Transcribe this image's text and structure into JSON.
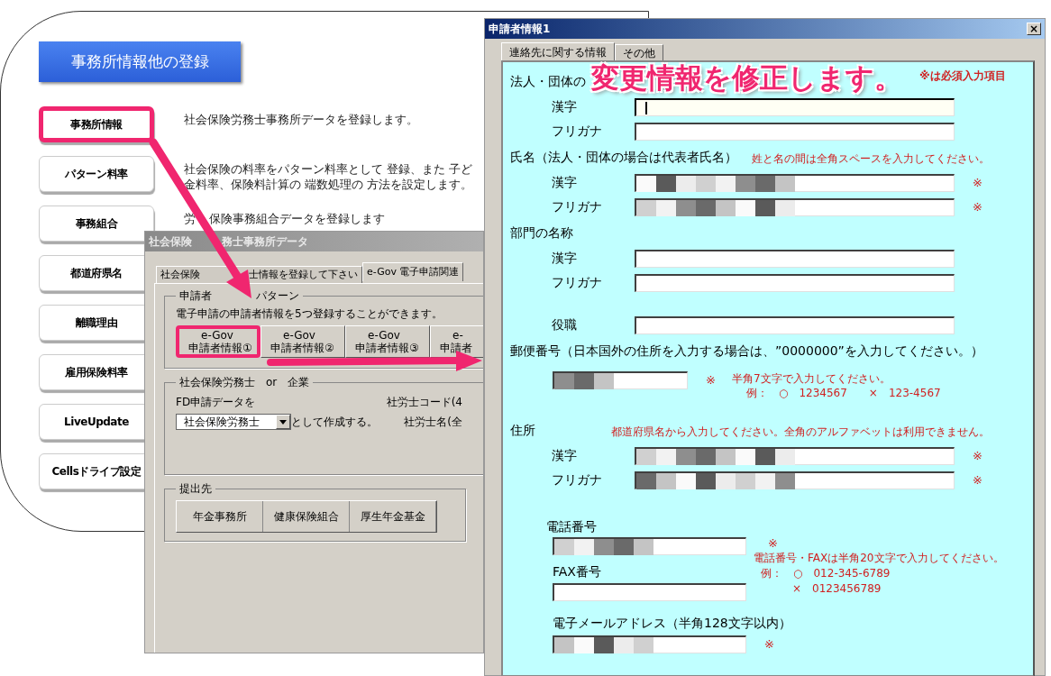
{
  "left_panel": {
    "header": "事務所情報他の登録",
    "items": [
      {
        "label": "事務所情報",
        "highlighted": true,
        "description": [
          [
            "社会保険労務士事務所データを登録します。"
          ]
        ]
      },
      {
        "label": "パターン料率",
        "highlighted": false,
        "description": [
          [
            "社会保険の料率をパターン料率として 登録、また 子ど"
          ],
          [
            "金料率、保険料計算の 端数処理の 方法を設定します。"
          ]
        ]
      },
      {
        "label": "事務組合",
        "highlighted": false,
        "description": [
          [
            "労",
            "保険事務組合データを登録します"
          ]
        ]
      },
      {
        "label": "都道府県名",
        "highlighted": false
      },
      {
        "label": "離職理由",
        "highlighted": false
      },
      {
        "label": "雇用保険料率",
        "highlighted": false
      },
      {
        "label": "LiveUpdate",
        "highlighted": false
      },
      {
        "label": "Cellsドライブ設定",
        "highlighted": false
      }
    ]
  },
  "office_dialog": {
    "title": [
      "社会保険",
      "務士事務所データ"
    ],
    "tabs": [
      {
        "label": [
          "社会保険",
          "士情報を登録して下さい"
        ],
        "selected": false
      },
      {
        "label": [
          "e-Gov 電子申請関連"
        ],
        "selected": true
      }
    ],
    "pattern_group": {
      "legend": [
        "申請者",
        "パターン"
      ],
      "text": "電子申請の申請者情報を5つ登録することができます。",
      "buttons": [
        {
          "lines": [
            "e-Gov",
            "申請者情報①"
          ],
          "highlighted": true
        },
        {
          "lines": [
            "e-Gov",
            "申請者情報②"
          ],
          "highlighted": false
        },
        {
          "lines": [
            "e-Gov",
            "申請者情報③"
          ],
          "highlighted": false
        },
        {
          "lines": [
            "e-",
            "申請者"
          ],
          "highlighted": false
        }
      ]
    },
    "type_group": {
      "legend": "社会保険労務士　or　企業",
      "prompt": "FD申請データを",
      "select_value": "社会保険労務士",
      "suffix": "として作成する。",
      "code_label": "社労士コード(4",
      "name_label": "社労士名(全"
    },
    "destination_group": {
      "legend": "提出先",
      "buttons": [
        "年金事務所",
        "健康保険組合",
        "厚生年金基金"
      ]
    }
  },
  "applicant_dialog": {
    "title": "申請者情報1",
    "close": "×",
    "tabs": [
      {
        "label": "連絡先に関する情報",
        "selected": true
      },
      {
        "label": "その他",
        "selected": false
      }
    ],
    "banner": "変更情報を修正します。",
    "required_note": "※は必須入力項目",
    "sections": [
      {
        "kind": "heading",
        "label": "法人・団体の"
      },
      {
        "kind": "field",
        "label": "漢字",
        "masked": false,
        "focused": true
      },
      {
        "kind": "field",
        "label": "フリガナ",
        "masked": false,
        "focused": false
      },
      {
        "kind": "heading",
        "label": "氏名（法人・団体の場合は代表者氏名）",
        "note": "姓と名の間は全角スペースを入力してください。"
      },
      {
        "kind": "field",
        "label": "漢字",
        "masked": true,
        "focused": false,
        "mark": "※"
      },
      {
        "kind": "field",
        "label": "フリガナ",
        "masked": true,
        "focused": false,
        "mark": "※"
      },
      {
        "kind": "heading",
        "label": "部門の名称"
      },
      {
        "kind": "field",
        "label": "漢字",
        "masked": false,
        "focused": false
      },
      {
        "kind": "field",
        "label": "フリガナ",
        "masked": false,
        "focused": false
      },
      {
        "kind": "spaced_field",
        "label": "役職",
        "masked": false,
        "focused": false
      },
      {
        "kind": "heading",
        "label": "郵便番号（日本国外の住所を入力する場合は、”0000000”を入力してください。）"
      },
      {
        "kind": "short_field",
        "masked": true,
        "mark": "※",
        "notes": [
          "半角7文字で入力してください。",
          "例：　○　1234567　　×　123-4567"
        ]
      },
      {
        "kind": "heading",
        "label": "住所",
        "note": "都道府県名から入力してください。全角のアルファベットは利用できません。"
      },
      {
        "kind": "field",
        "label": "漢字",
        "masked": true,
        "focused": false,
        "mark": "※"
      },
      {
        "kind": "field",
        "label": "フリガナ",
        "masked": true,
        "focused": false,
        "mark": "※"
      },
      {
        "kind": "contact",
        "phone": {
          "label": "電話番号",
          "masked": true,
          "mark": "※"
        },
        "fax": {
          "label": "FAX番号",
          "masked": false
        },
        "notes": [
          "電話番号・FAXは半角20文字で入力してください。",
          "例：　○　012-345-6789",
          "×　0123456789"
        ],
        "email": {
          "label": "電子メールアドレス（半角128文字以内）",
          "masked": true,
          "mark": "※"
        }
      }
    ]
  }
}
